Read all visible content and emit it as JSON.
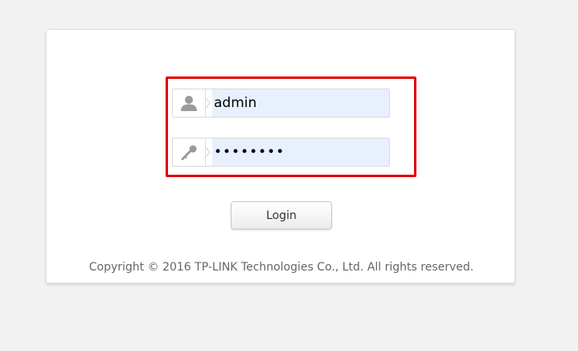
{
  "login_form": {
    "username_value": "admin",
    "password_value": "••••••••",
    "login_label": "Login",
    "icons": {
      "username": "user-icon",
      "password": "key-icon"
    },
    "highlight_color": "#e00000",
    "input_fill_color": "#e8f0fe"
  },
  "footer": {
    "copyright": "Copyright © 2016 TP-LINK Technologies Co., Ltd. All rights reserved."
  }
}
